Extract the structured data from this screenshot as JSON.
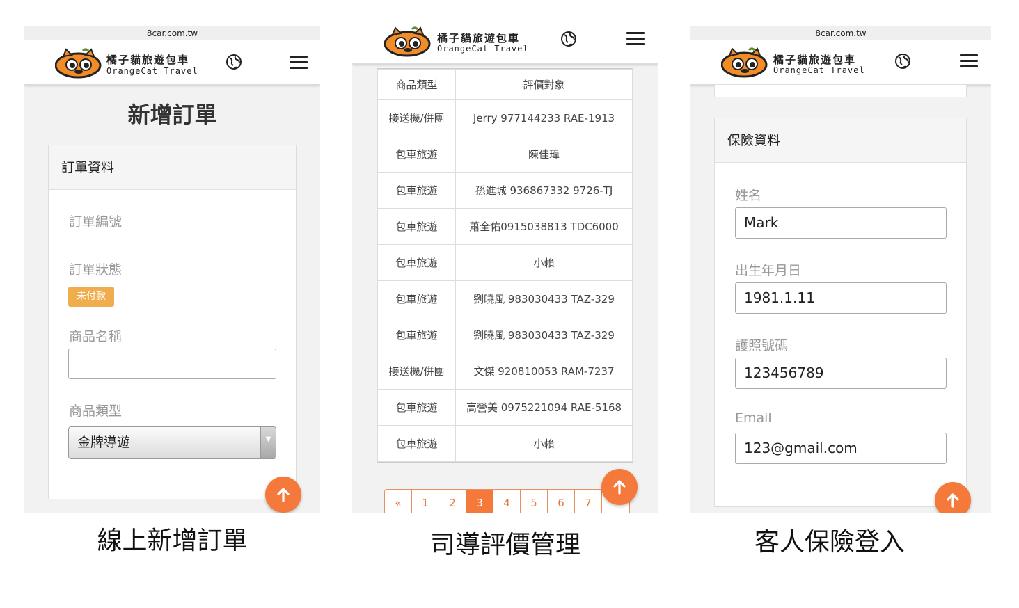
{
  "panels": {
    "order": {
      "url": "8car.com.tw",
      "brand_cn": "橘子貓旅遊包車",
      "brand_en": "OrangeCat Travel",
      "page_title": "新增訂單",
      "card_title": "訂單資料",
      "label_order_no": "訂單編號",
      "label_status": "訂單狀態",
      "status_badge": "未付款",
      "label_product_name": "商品名稱",
      "product_name_value": "",
      "label_product_type": "商品類型",
      "product_type_value": "金牌導遊",
      "caption": "線上新增訂單"
    },
    "reviews": {
      "brand_cn": "橘子貓旅遊包車",
      "brand_en": "OrangeCat Travel",
      "col_type": "商品類型",
      "col_target": "評價對象",
      "rows": [
        {
          "type": "接送機/併團",
          "target": "Jerry 977144233 RAE-1913"
        },
        {
          "type": "包車旅遊",
          "target": "陳佳瑋"
        },
        {
          "type": "包車旅遊",
          "target": "孫進城 936867332 9726-TJ"
        },
        {
          "type": "包車旅遊",
          "target": "蕭全佑0915038813 TDC6000"
        },
        {
          "type": "包車旅遊",
          "target": "小賴"
        },
        {
          "type": "包車旅遊",
          "target": "劉曉風 983030433 TAZ-329"
        },
        {
          "type": "包車旅遊",
          "target": "劉曉風 983030433 TAZ-329"
        },
        {
          "type": "接送機/併團",
          "target": "文傑 920810053 RAM-7237"
        },
        {
          "type": "包車旅遊",
          "target": "高營美 0975221094 RAE-5168"
        },
        {
          "type": "包車旅遊",
          "target": "小賴"
        }
      ],
      "pager": [
        "«",
        "1",
        "2",
        "3",
        "4",
        "5",
        "6",
        "7",
        ""
      ],
      "active_page": "3",
      "caption": "司導評價管理"
    },
    "insurance": {
      "url": "8car.com.tw",
      "brand_cn": "橘子貓旅遊包車",
      "brand_en": "OrangeCat Travel",
      "card_title": "保險資料",
      "label_name": "姓名",
      "name_value": "Mark",
      "label_birth": "出生年月日",
      "birth_value": "1981.1.11",
      "label_passport": "護照號碼",
      "passport_value": "123456789",
      "label_email": "Email",
      "email_value": "123@gmail.com",
      "caption": "客人保險登入"
    }
  },
  "colors": {
    "accent": "#f4793b",
    "badge": "#f0ad4e",
    "panel_bg": "#f2f2f2"
  },
  "icons": [
    "orangecat-logo-icon",
    "globe-icon",
    "hamburger-menu-icon",
    "arrow-up-icon",
    "select-caret-icon"
  ]
}
